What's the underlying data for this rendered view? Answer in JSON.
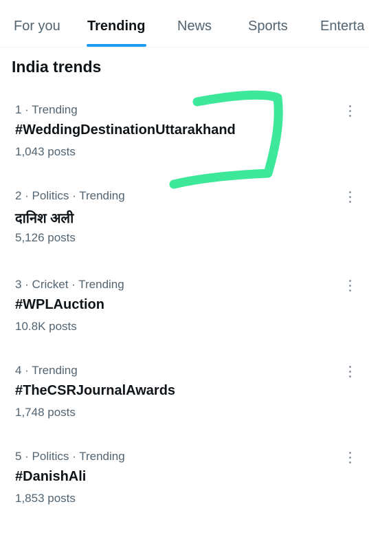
{
  "tabs": [
    {
      "label": "For you",
      "active": false
    },
    {
      "label": "Trending",
      "active": true
    },
    {
      "label": "News",
      "active": false
    },
    {
      "label": "Sports",
      "active": false
    },
    {
      "label": "Enterta",
      "active": false
    }
  ],
  "section_title": "India trends",
  "accent_color": "#1d9bf0",
  "annotation_color": "#3ee89a",
  "more_icon": "more-vertical-icon",
  "trends": [
    {
      "meta": "1 · Trending",
      "name": "#WeddingDestinationUttarakhand",
      "count": "1,043 posts"
    },
    {
      "meta": "2 · Politics · Trending",
      "name": "दानिश अली",
      "count": "5,126 posts"
    },
    {
      "meta": "3 · Cricket · Trending",
      "name": "#WPLAuction",
      "count": "10.8K posts"
    },
    {
      "meta": "4 · Trending",
      "name": "#TheCSRJournalAwards",
      "count": "1,748 posts"
    },
    {
      "meta": "5 · Politics · Trending",
      "name": "#DanishAli",
      "count": "1,853 posts"
    }
  ]
}
